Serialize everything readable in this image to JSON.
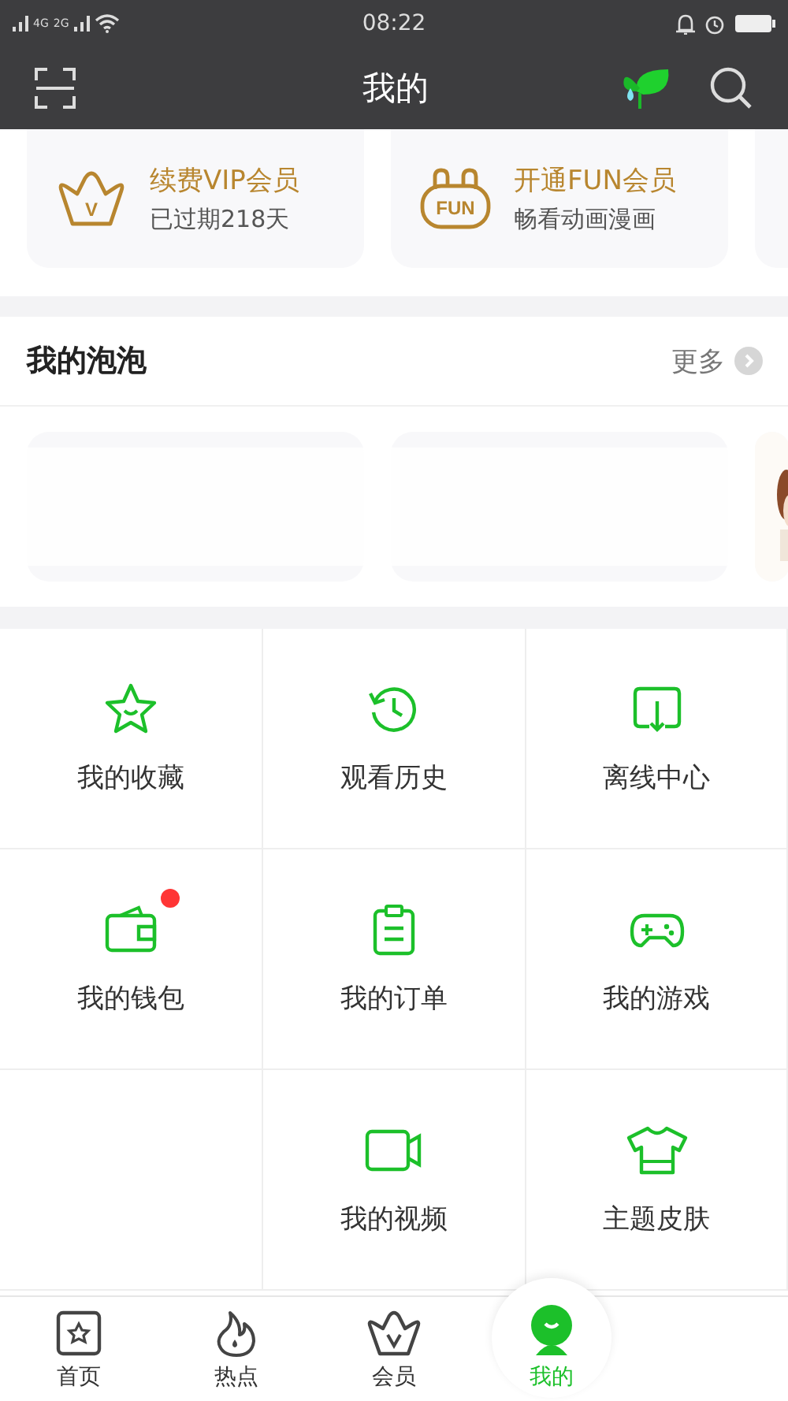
{
  "status_bar": {
    "network_1": "4G",
    "network_2": "2G",
    "time": "08:22"
  },
  "header": {
    "title": "我的"
  },
  "vip_cards": [
    {
      "kind": "crown",
      "badge": "V",
      "title": "续费VIP会员",
      "subtitle": "已过期218天"
    },
    {
      "kind": "fun",
      "badge": "FUN",
      "title": "开通FUN会员",
      "subtitle": "畅看动画漫画"
    }
  ],
  "bubbles": {
    "title": "我的泡泡",
    "more": "更多"
  },
  "grid": [
    {
      "kind": "star",
      "label": "我的收藏",
      "badge": false
    },
    {
      "kind": "history",
      "label": "观看历史",
      "badge": false
    },
    {
      "kind": "download",
      "label": "离线中心",
      "badge": false
    },
    {
      "kind": "wallet",
      "label": "我的钱包",
      "badge": true
    },
    {
      "kind": "order",
      "label": "我的订单",
      "badge": false
    },
    {
      "kind": "game",
      "label": "我的游戏",
      "badge": false
    },
    {
      "kind": "empty"
    },
    {
      "kind": "video",
      "label": "我的视频",
      "badge": false
    },
    {
      "kind": "shirt",
      "label": "主题皮肤",
      "badge": false
    }
  ],
  "tabs": [
    {
      "kind": "home",
      "label": "首页",
      "selected": false
    },
    {
      "kind": "hot",
      "label": "热点",
      "selected": false
    },
    {
      "kind": "vip",
      "label": "会员",
      "selected": false
    },
    {
      "kind": "me",
      "label": "我的",
      "selected": true
    }
  ]
}
